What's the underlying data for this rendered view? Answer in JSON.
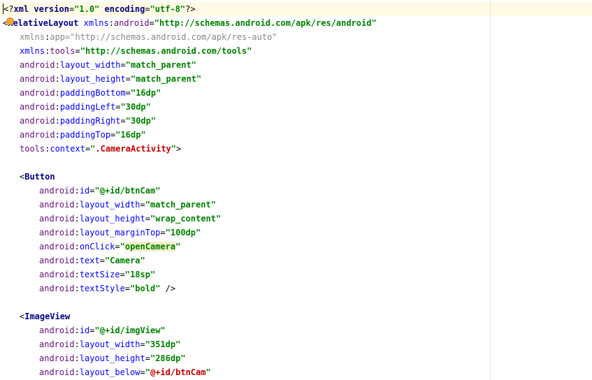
{
  "editor": {
    "lines": [
      {
        "indent": 0,
        "tokens": [
          {
            "t": "<?",
            "c": "punct"
          },
          {
            "t": "xml version",
            "c": "tag"
          },
          {
            "t": "=",
            "c": "punct"
          },
          {
            "t": "\"1.0\"",
            "c": "str"
          },
          {
            "t": " ",
            "c": "punct"
          },
          {
            "t": "encoding",
            "c": "tag"
          },
          {
            "t": "=",
            "c": "punct"
          },
          {
            "t": "\"utf-8\"",
            "c": "str"
          },
          {
            "t": "?>",
            "c": "punct"
          }
        ]
      },
      {
        "indent": 0,
        "tokens": [
          {
            "t": "<",
            "c": "punct"
          },
          {
            "t": "RelativeLayout",
            "c": "tag"
          },
          {
            "t": " ",
            "c": "punct"
          },
          {
            "t": "xmlns",
            "c": "an"
          },
          {
            "t": ":",
            "c": "colon"
          },
          {
            "t": "android",
            "c": "pfx"
          },
          {
            "t": "=",
            "c": "punct"
          },
          {
            "t": "\"http://schemas.android.com/apk/res/android\"",
            "c": "str"
          }
        ]
      },
      {
        "indent": 1,
        "dim": true,
        "tokens": [
          {
            "t": "xmlns",
            "c": "an"
          },
          {
            "t": ":",
            "c": "colon"
          },
          {
            "t": "app",
            "c": "pfx"
          },
          {
            "t": "=",
            "c": "punct"
          },
          {
            "t": "\"http://schemas.android.com/apk/res-auto\"",
            "c": "str"
          }
        ]
      },
      {
        "indent": 1,
        "tokens": [
          {
            "t": "xmlns",
            "c": "an"
          },
          {
            "t": ":",
            "c": "colon"
          },
          {
            "t": "tools",
            "c": "pfx"
          },
          {
            "t": "=",
            "c": "punct"
          },
          {
            "t": "\"http://schemas.android.com/tools\"",
            "c": "str"
          }
        ]
      },
      {
        "indent": 1,
        "tokens": [
          {
            "t": "android",
            "c": "pfx"
          },
          {
            "t": ":",
            "c": "colon"
          },
          {
            "t": "layout_width",
            "c": "an"
          },
          {
            "t": "=",
            "c": "punct"
          },
          {
            "t": "\"match_parent\"",
            "c": "str"
          }
        ]
      },
      {
        "indent": 1,
        "tokens": [
          {
            "t": "android",
            "c": "pfx"
          },
          {
            "t": ":",
            "c": "colon"
          },
          {
            "t": "layout_height",
            "c": "an"
          },
          {
            "t": "=",
            "c": "punct"
          },
          {
            "t": "\"match_parent\"",
            "c": "str"
          }
        ]
      },
      {
        "indent": 1,
        "tokens": [
          {
            "t": "android",
            "c": "pfx"
          },
          {
            "t": ":",
            "c": "colon"
          },
          {
            "t": "paddingBottom",
            "c": "an"
          },
          {
            "t": "=",
            "c": "punct"
          },
          {
            "t": "\"16dp\"",
            "c": "str"
          }
        ]
      },
      {
        "indent": 1,
        "tokens": [
          {
            "t": "android",
            "c": "pfx"
          },
          {
            "t": ":",
            "c": "colon"
          },
          {
            "t": "paddingLeft",
            "c": "an"
          },
          {
            "t": "=",
            "c": "punct"
          },
          {
            "t": "\"30dp\"",
            "c": "str"
          }
        ]
      },
      {
        "indent": 1,
        "tokens": [
          {
            "t": "android",
            "c": "pfx"
          },
          {
            "t": ":",
            "c": "colon"
          },
          {
            "t": "paddingRight",
            "c": "an"
          },
          {
            "t": "=",
            "c": "punct"
          },
          {
            "t": "\"30dp\"",
            "c": "str"
          }
        ]
      },
      {
        "indent": 1,
        "tokens": [
          {
            "t": "android",
            "c": "pfx"
          },
          {
            "t": ":",
            "c": "colon"
          },
          {
            "t": "paddingTop",
            "c": "an"
          },
          {
            "t": "=",
            "c": "punct"
          },
          {
            "t": "\"16dp\"",
            "c": "str"
          }
        ]
      },
      {
        "indent": 1,
        "tokens": [
          {
            "t": "tools",
            "c": "pfx"
          },
          {
            "t": ":",
            "c": "colon"
          },
          {
            "t": "context",
            "c": "an"
          },
          {
            "t": "=",
            "c": "punct"
          },
          {
            "t": "\"",
            "c": "str"
          },
          {
            "t": ".CameraActivity",
            "c": "ref"
          },
          {
            "t": "\"",
            "c": "str"
          },
          {
            "t": ">",
            "c": "punct"
          }
        ]
      },
      {
        "indent": 0,
        "tokens": []
      },
      {
        "indent": 1,
        "tokens": [
          {
            "t": "<",
            "c": "punct"
          },
          {
            "t": "Button",
            "c": "tag"
          }
        ]
      },
      {
        "indent": 2,
        "tokens": [
          {
            "t": "android",
            "c": "pfx"
          },
          {
            "t": ":",
            "c": "colon"
          },
          {
            "t": "id",
            "c": "an"
          },
          {
            "t": "=",
            "c": "punct"
          },
          {
            "t": "\"@+id/btnCam\"",
            "c": "str"
          }
        ]
      },
      {
        "indent": 2,
        "tokens": [
          {
            "t": "android",
            "c": "pfx"
          },
          {
            "t": ":",
            "c": "colon"
          },
          {
            "t": "layout_width",
            "c": "an"
          },
          {
            "t": "=",
            "c": "punct"
          },
          {
            "t": "\"match_parent\"",
            "c": "str"
          }
        ]
      },
      {
        "indent": 2,
        "tokens": [
          {
            "t": "android",
            "c": "pfx"
          },
          {
            "t": ":",
            "c": "colon"
          },
          {
            "t": "layout_height",
            "c": "an"
          },
          {
            "t": "=",
            "c": "punct"
          },
          {
            "t": "\"wrap_content\"",
            "c": "str"
          }
        ]
      },
      {
        "indent": 2,
        "tokens": [
          {
            "t": "android",
            "c": "pfx"
          },
          {
            "t": ":",
            "c": "colon"
          },
          {
            "t": "layout_marginTop",
            "c": "an"
          },
          {
            "t": "=",
            "c": "punct"
          },
          {
            "t": "\"100dp\"",
            "c": "str"
          }
        ]
      },
      {
        "indent": 2,
        "tokens": [
          {
            "t": "android",
            "c": "pfx"
          },
          {
            "t": ":",
            "c": "colon"
          },
          {
            "t": "onClick",
            "c": "an"
          },
          {
            "t": "=",
            "c": "punct"
          },
          {
            "t": "\"",
            "c": "str"
          },
          {
            "t": "openCamera",
            "c": "str",
            "hl": true
          },
          {
            "t": "\"",
            "c": "str"
          }
        ]
      },
      {
        "indent": 2,
        "tokens": [
          {
            "t": "android",
            "c": "pfx"
          },
          {
            "t": ":",
            "c": "colon"
          },
          {
            "t": "text",
            "c": "an"
          },
          {
            "t": "=",
            "c": "punct"
          },
          {
            "t": "\"Camera\"",
            "c": "str"
          }
        ]
      },
      {
        "indent": 2,
        "tokens": [
          {
            "t": "android",
            "c": "pfx"
          },
          {
            "t": ":",
            "c": "colon"
          },
          {
            "t": "textSize",
            "c": "an"
          },
          {
            "t": "=",
            "c": "punct"
          },
          {
            "t": "\"18sp\"",
            "c": "str"
          }
        ]
      },
      {
        "indent": 2,
        "tokens": [
          {
            "t": "android",
            "c": "pfx"
          },
          {
            "t": ":",
            "c": "colon"
          },
          {
            "t": "textStyle",
            "c": "an"
          },
          {
            "t": "=",
            "c": "punct"
          },
          {
            "t": "\"bold\"",
            "c": "str"
          },
          {
            "t": " />",
            "c": "punct"
          }
        ]
      },
      {
        "indent": 0,
        "tokens": []
      },
      {
        "indent": 1,
        "tokens": [
          {
            "t": "<",
            "c": "punct"
          },
          {
            "t": "ImageView",
            "c": "tag"
          }
        ]
      },
      {
        "indent": 2,
        "tokens": [
          {
            "t": "android",
            "c": "pfx"
          },
          {
            "t": ":",
            "c": "colon"
          },
          {
            "t": "id",
            "c": "an"
          },
          {
            "t": "=",
            "c": "punct"
          },
          {
            "t": "\"@+id/imgView\"",
            "c": "str"
          }
        ]
      },
      {
        "indent": 2,
        "tokens": [
          {
            "t": "android",
            "c": "pfx"
          },
          {
            "t": ":",
            "c": "colon"
          },
          {
            "t": "layout_width",
            "c": "an"
          },
          {
            "t": "=",
            "c": "punct"
          },
          {
            "t": "\"351dp\"",
            "c": "str"
          }
        ]
      },
      {
        "indent": 2,
        "tokens": [
          {
            "t": "android",
            "c": "pfx"
          },
          {
            "t": ":",
            "c": "colon"
          },
          {
            "t": "layout_height",
            "c": "an"
          },
          {
            "t": "=",
            "c": "punct"
          },
          {
            "t": "\"286dp\"",
            "c": "str"
          }
        ]
      },
      {
        "indent": 2,
        "tokens": [
          {
            "t": "android",
            "c": "pfx"
          },
          {
            "t": ":",
            "c": "colon"
          },
          {
            "t": "layout_below",
            "c": "an"
          },
          {
            "t": "=",
            "c": "punct"
          },
          {
            "t": "\"",
            "c": "str"
          },
          {
            "t": "@+id/btnCam",
            "c": "ref"
          },
          {
            "t": "\"",
            "c": "str"
          }
        ]
      }
    ],
    "bulb_icon": "intention-bulb-icon",
    "colors": {
      "background": "#ffffff",
      "current_line": "#fffae3",
      "tag": "#000080",
      "attr_namespace": "#660e7a",
      "attr_name": "#0000ff",
      "string": "#008000",
      "reference": "#c00000",
      "unused": "#888888"
    }
  }
}
